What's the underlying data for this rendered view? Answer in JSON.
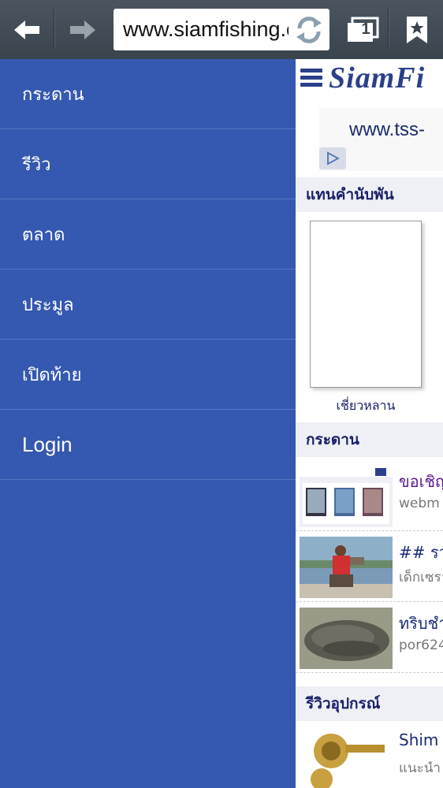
{
  "browser": {
    "url": "www.siamfishing.com",
    "tab_count": "1"
  },
  "drawer": {
    "items": [
      {
        "label": "กระดาน"
      },
      {
        "label": "รีวิว"
      },
      {
        "label": "ตลาด"
      },
      {
        "label": "ประมูล"
      },
      {
        "label": "เปิดท้าย"
      },
      {
        "label": "Login"
      }
    ]
  },
  "site": {
    "logo": "SiamFi",
    "ad_text": "www.tss-",
    "section_top": "แทนคำนับพัน",
    "thumb_caption": "เชี่ยวหลาน",
    "section_board": "กระดาน",
    "posts": [
      {
        "title": "ขอเชิญ",
        "author": "webm"
      },
      {
        "title": "## รว",
        "author": "เด็กเซรา"
      },
      {
        "title": "ทริบชำ",
        "author": "por624"
      }
    ],
    "section_review": "รีวิวอุปกรณ์",
    "review_post": {
      "title": "Shim",
      "author": "แนะนำ"
    }
  },
  "colors": {
    "drawer_bg": "#3558b0",
    "toolbar_bg": "#424c55",
    "site_accent": "#2b3f8a"
  }
}
